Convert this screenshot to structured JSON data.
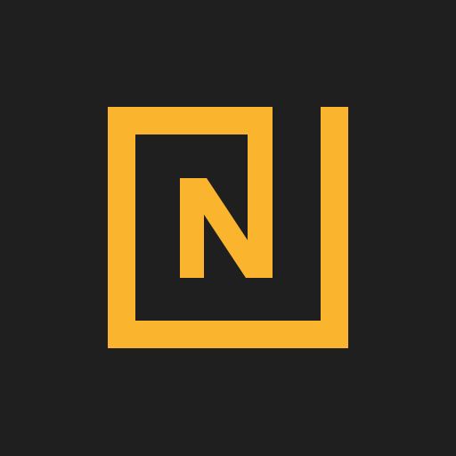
{
  "colors": {
    "background": "#1f1f1f",
    "accent": "#fbb42d"
  },
  "logo": {
    "icon": "n-logo-icon",
    "letter": "N"
  }
}
